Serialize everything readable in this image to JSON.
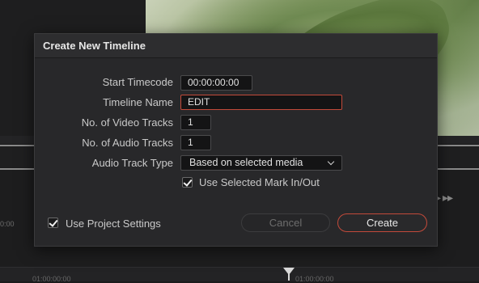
{
  "background": {
    "timecode_left": "0:00",
    "timecode_bottom_left": "01:00:00:00",
    "timecode_bottom_right": "01:00:00:00",
    "transport_icon": "fast-forward-icon"
  },
  "dialog": {
    "title": "Create New Timeline",
    "fields": {
      "start_timecode": {
        "label": "Start Timecode",
        "value": "00:00:00:00"
      },
      "timeline_name": {
        "label": "Timeline Name",
        "value": "EDIT"
      },
      "video_tracks": {
        "label": "No. of Video Tracks",
        "value": "1"
      },
      "audio_tracks": {
        "label": "No. of Audio Tracks",
        "value": "1"
      },
      "audio_track_type": {
        "label": "Audio Track Type",
        "selected": "Based on selected media"
      }
    },
    "use_selected_mark": {
      "label": "Use Selected Mark In/Out",
      "checked": true
    },
    "use_project_settings": {
      "label": "Use Project Settings",
      "checked": true
    },
    "buttons": {
      "cancel": "Cancel",
      "create": "Create"
    },
    "colors": {
      "accent": "#c34a3a",
      "dialog_bg": "#28282a",
      "field_bg": "#141415"
    }
  }
}
